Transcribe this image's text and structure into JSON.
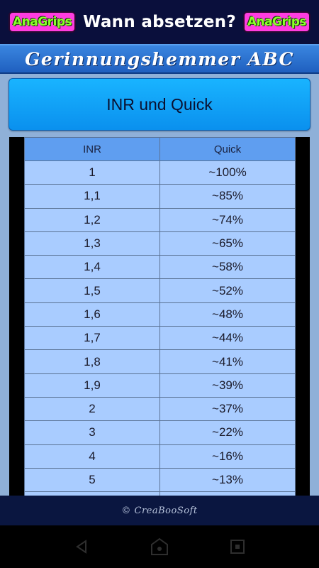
{
  "header": {
    "logo_left": "AnaGrips",
    "title": "Wann absetzen?",
    "logo_right": "AnaGrips"
  },
  "app": {
    "title": "Gerinnungshemmer ABC"
  },
  "main_button": {
    "label": "INR und Quick"
  },
  "table": {
    "columns": [
      "INR",
      "Quick"
    ],
    "rows": [
      [
        "1",
        "~100%"
      ],
      [
        "1,1",
        "~85%"
      ],
      [
        "1,2",
        "~74%"
      ],
      [
        "1,3",
        "~65%"
      ],
      [
        "1,4",
        "~58%"
      ],
      [
        "1,5",
        "~52%"
      ],
      [
        "1,6",
        "~48%"
      ],
      [
        "1,7",
        "~44%"
      ],
      [
        "1,8",
        "~41%"
      ],
      [
        "1,9",
        "~39%"
      ],
      [
        "2",
        "~37%"
      ],
      [
        "3",
        "~22%"
      ],
      [
        "4",
        "~16%"
      ],
      [
        "5",
        "~13%"
      ],
      [
        "",
        ""
      ]
    ]
  },
  "footer": {
    "text": "© CreaBooSoft"
  },
  "navbar": {
    "icons": [
      "back-icon",
      "home-icon",
      "recents-icon"
    ],
    "color": "#2a2a2a"
  }
}
